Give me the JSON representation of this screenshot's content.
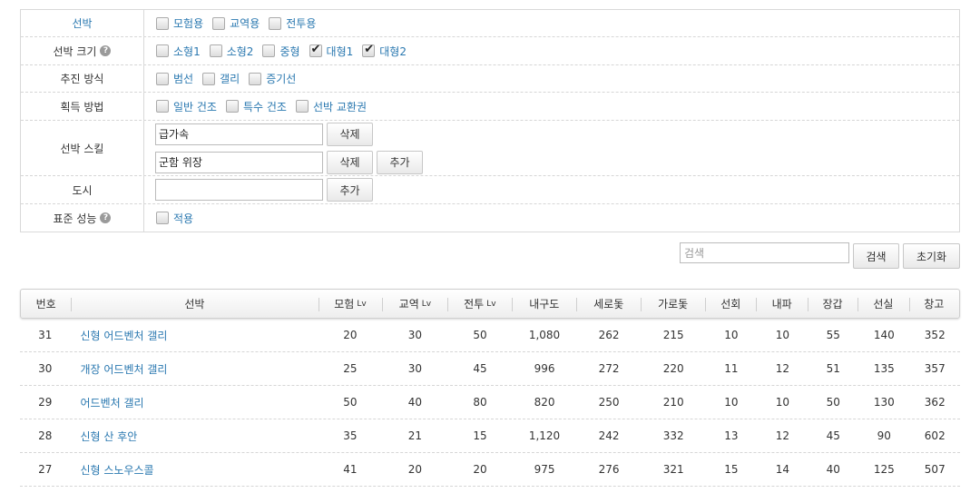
{
  "filters": {
    "ship_type": {
      "label": "선박",
      "options": [
        {
          "label": "모험용",
          "checked": false
        },
        {
          "label": "교역용",
          "checked": false
        },
        {
          "label": "전투용",
          "checked": false
        }
      ]
    },
    "ship_size": {
      "label": "선박 크기",
      "options": [
        {
          "label": "소형1",
          "checked": false
        },
        {
          "label": "소형2",
          "checked": false
        },
        {
          "label": "중형",
          "checked": false
        },
        {
          "label": "대형1",
          "checked": true
        },
        {
          "label": "대형2",
          "checked": true
        }
      ]
    },
    "propulsion": {
      "label": "추진 방식",
      "options": [
        {
          "label": "범선",
          "checked": false
        },
        {
          "label": "갤리",
          "checked": false
        },
        {
          "label": "증기선",
          "checked": false
        }
      ]
    },
    "acquisition": {
      "label": "획득 방법",
      "options": [
        {
          "label": "일반 건조",
          "checked": false
        },
        {
          "label": "특수 건조",
          "checked": false
        },
        {
          "label": "선박 교환권",
          "checked": false
        }
      ]
    },
    "ship_skill": {
      "label": "선박 스킬",
      "values": [
        "급가속",
        "군함 위장"
      ],
      "delete_label": "삭제",
      "add_label": "추가"
    },
    "city": {
      "label": "도시",
      "value": "",
      "add_label": "추가"
    },
    "standard_perf": {
      "label": "표준 성능",
      "options": [
        {
          "label": "적용",
          "checked": false
        }
      ]
    }
  },
  "search": {
    "placeholder": "검색",
    "search_label": "검색",
    "reset_label": "초기화"
  },
  "table": {
    "headers": [
      "번호",
      "선박",
      "모험",
      "교역",
      "전투",
      "내구도",
      "세로돛",
      "가로돛",
      "선회",
      "내파",
      "장갑",
      "선실",
      "창고"
    ],
    "lv_suffix": "Lv",
    "rows": [
      [
        "31",
        "신형 어드벤처 갤리",
        "20",
        "30",
        "50",
        "1,080",
        "262",
        "215",
        "10",
        "10",
        "55",
        "140",
        "352"
      ],
      [
        "30",
        "개장 어드벤처 갤리",
        "25",
        "30",
        "45",
        "996",
        "272",
        "220",
        "11",
        "12",
        "51",
        "135",
        "357"
      ],
      [
        "29",
        "어드벤처 갤리",
        "50",
        "40",
        "80",
        "820",
        "250",
        "210",
        "10",
        "10",
        "50",
        "130",
        "362"
      ],
      [
        "28",
        "신형 산 후안",
        "35",
        "21",
        "15",
        "1,120",
        "242",
        "332",
        "13",
        "12",
        "45",
        "90",
        "602"
      ],
      [
        "27",
        "신형 스노우스콜",
        "41",
        "20",
        "20",
        "975",
        "276",
        "321",
        "15",
        "14",
        "40",
        "125",
        "507"
      ]
    ]
  },
  "colors": {
    "link": "#2a78b0",
    "border": "#d9d9d9"
  },
  "icons": {
    "help": "question-circle-icon",
    "check": "checkmark-icon"
  }
}
